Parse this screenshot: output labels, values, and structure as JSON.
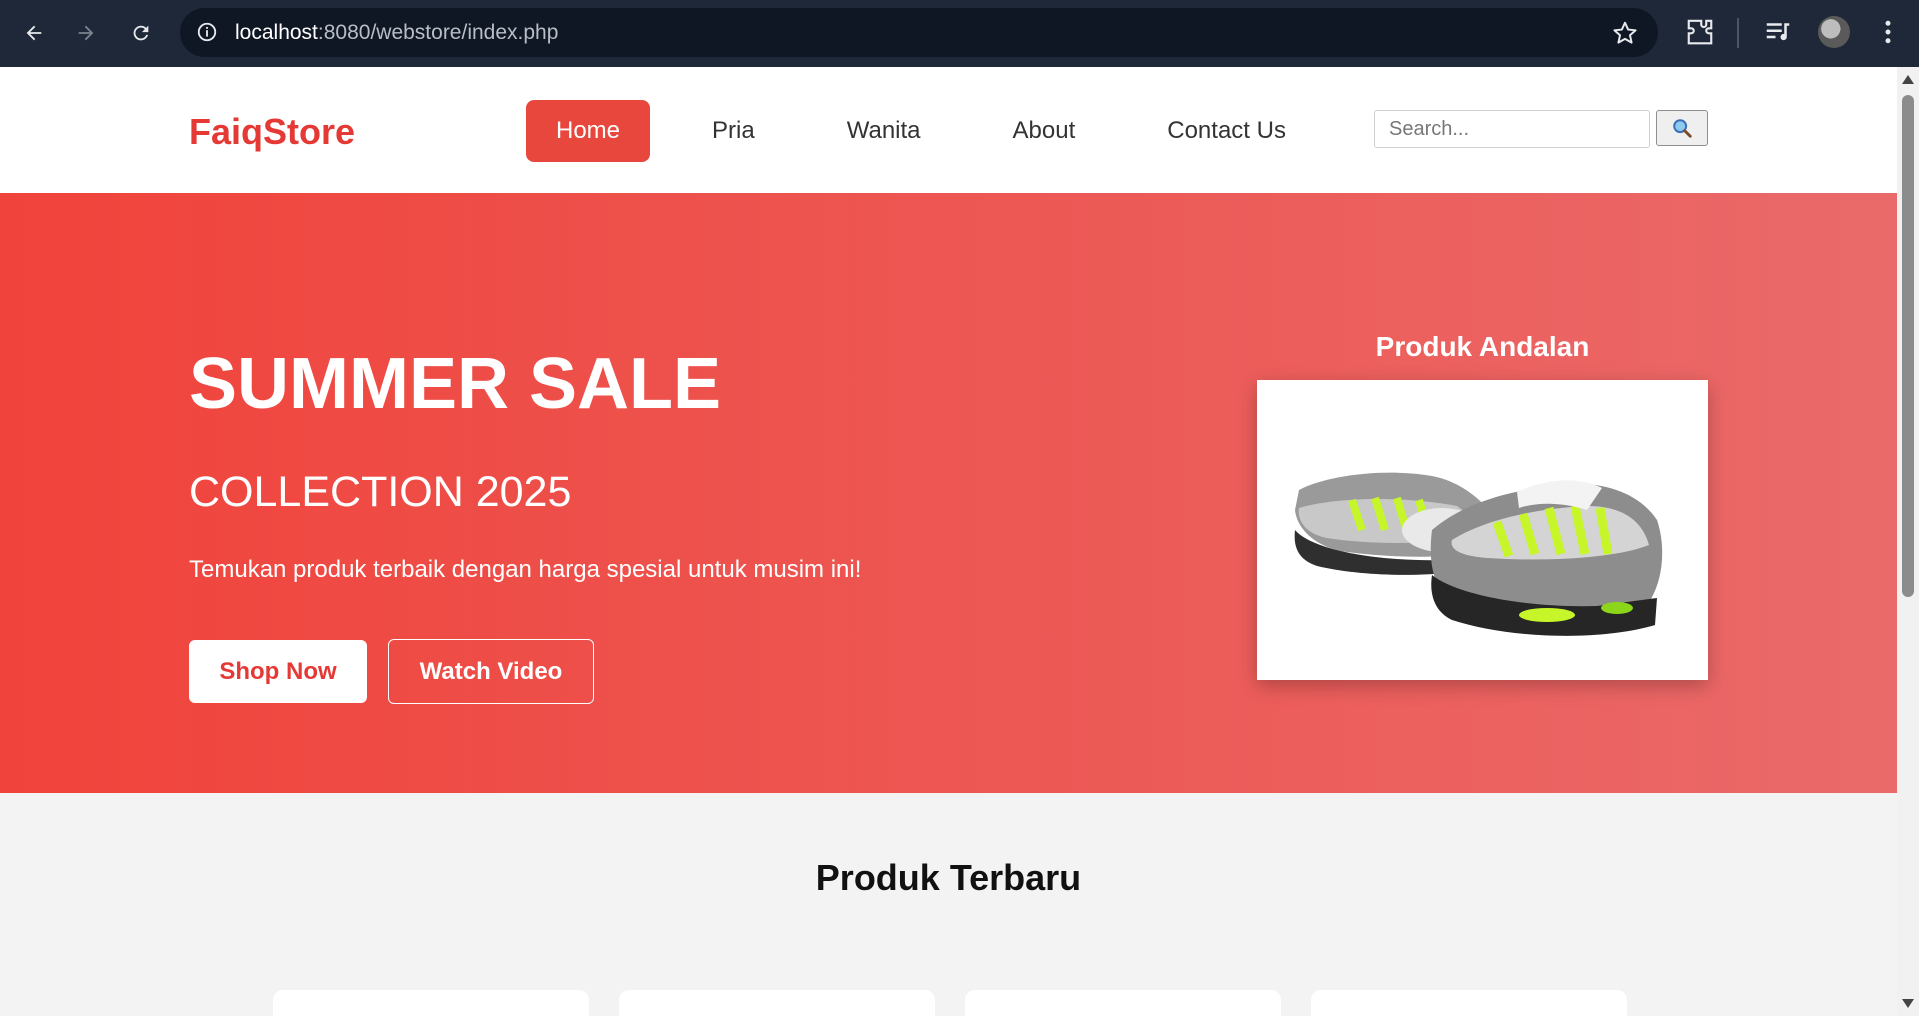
{
  "browser": {
    "url_host": "localhost",
    "url_rest": ":8080/webstore/index.php"
  },
  "store": {
    "logo": "FaiqStore",
    "nav": [
      {
        "label": "Home",
        "active": true
      },
      {
        "label": "Pria",
        "active": false
      },
      {
        "label": "Wanita",
        "active": false
      },
      {
        "label": "About",
        "active": false
      },
      {
        "label": "Contact Us",
        "active": false
      }
    ],
    "search": {
      "placeholder": "Search...",
      "button_icon": "magnifier-icon"
    }
  },
  "hero": {
    "title": "SUMMER SALE",
    "subtitle": "COLLECTION 2025",
    "description": "Temukan produk terbaik dengan harga spesial untuk musim ini!",
    "shop_label": "Shop Now",
    "video_label": "Watch Video",
    "featured_title": "Produk Andalan"
  },
  "products": {
    "title": "Produk Terbaru",
    "card_count": 4
  },
  "colors": {
    "accent": "#e53935",
    "hero_start": "#f0433b",
    "hero_end": "#ea6a6a",
    "chrome_bg": "#1f2838"
  }
}
